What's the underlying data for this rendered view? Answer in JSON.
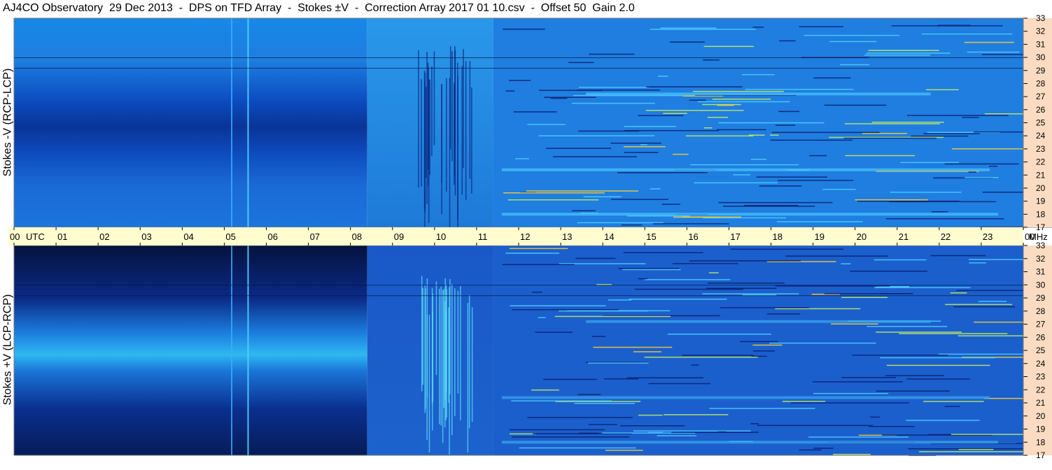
{
  "header": {
    "title": "AJ4CO Observatory  29 Dec 2013  -  DPS on TFD Array  -  Stokes ±V  -  Correction Array 2017 01 10.csv  -  Offset 50  Gain 2.0"
  },
  "colors": {
    "time_strip": "#fffdd0",
    "freq_strip": "#fbdcc2",
    "border": "#7a7a7a",
    "background": "#ffffff"
  },
  "chart_data": [
    {
      "type": "heatmap",
      "title": "",
      "ylabel": "Stokes -V (RCP-LCP)",
      "xlabel": "",
      "x_unit": "UTC",
      "y_unit": "",
      "x_range": [
        0,
        24
      ],
      "y_range": [
        17,
        33
      ],
      "y_ticks": [
        "17",
        "18",
        "19",
        "20",
        "21",
        "22",
        "23",
        "24",
        "25",
        "26",
        "27",
        "28",
        "29",
        "30",
        "31",
        "32",
        "33"
      ],
      "colormap": "dark blue - cyan - yellow - red"
    },
    {
      "type": "heatmap",
      "title": "",
      "ylabel": "Stokes +V (LCP-RCP)",
      "xlabel": "",
      "x_unit": "UTC",
      "y_unit": "MHz",
      "x_range": [
        0,
        24
      ],
      "y_range": [
        17,
        33
      ],
      "y_ticks": [
        "17",
        "18",
        "19",
        "20",
        "21",
        "22",
        "23",
        "24",
        "25",
        "26",
        "27",
        "28",
        "29",
        "30",
        "31",
        "32",
        "33"
      ],
      "x_ticks": [
        "00",
        "01",
        "02",
        "03",
        "04",
        "05",
        "06",
        "07",
        "08",
        "09",
        "10",
        "11",
        "12",
        "13",
        "14",
        "15",
        "16",
        "17",
        "18",
        "19",
        "20",
        "21",
        "22",
        "23",
        "00"
      ],
      "colormap": "dark blue - cyan - yellow - red"
    }
  ]
}
